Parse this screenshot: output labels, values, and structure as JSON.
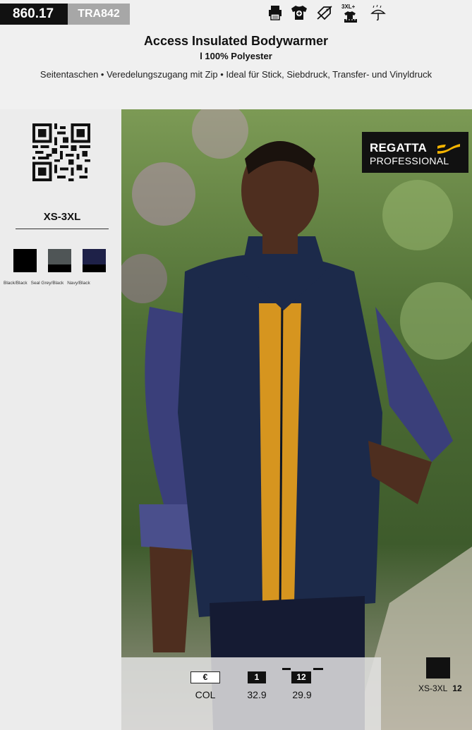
{
  "header": {
    "article_no": "860.17",
    "supplier_code": "TRA842",
    "title": "Access Insulated Bodywarmer",
    "subtitle": "l 100% Polyester",
    "features": "Seitentaschen • Veredelungszugang mit Zip • Ideal für Stick, Siebdruck, Transfer- und Vinyldruck",
    "icons": [
      "printer-icon",
      "tshirt-embroidery-icon",
      "no-bleach-tag-icon",
      "size-3xl-plus-icon",
      "rain-umbrella-icon"
    ],
    "size_badge": "3XL+"
  },
  "sidebar": {
    "size_range": "XS-3XL",
    "colors": [
      {
        "name": "Black/Black",
        "top": "#000000",
        "bottom": "#000000"
      },
      {
        "name": "Seal Grey/Black",
        "top": "#4f5556",
        "bottom": "#000000"
      },
      {
        "name": "Navy/Black",
        "top": "#1e2148",
        "bottom": "#000000"
      }
    ]
  },
  "brand": {
    "line1": "REGATTA",
    "line2": "PROFESSIONAL",
    "accent": "#f5b400"
  },
  "pricing": {
    "currency": "€",
    "color_label": "COL",
    "tiers": [
      {
        "qty": "1",
        "price": "32.9"
      },
      {
        "qty": "12",
        "price": "29.9"
      }
    ]
  },
  "carton": {
    "sizes": "XS-3XL",
    "qty": "12"
  }
}
